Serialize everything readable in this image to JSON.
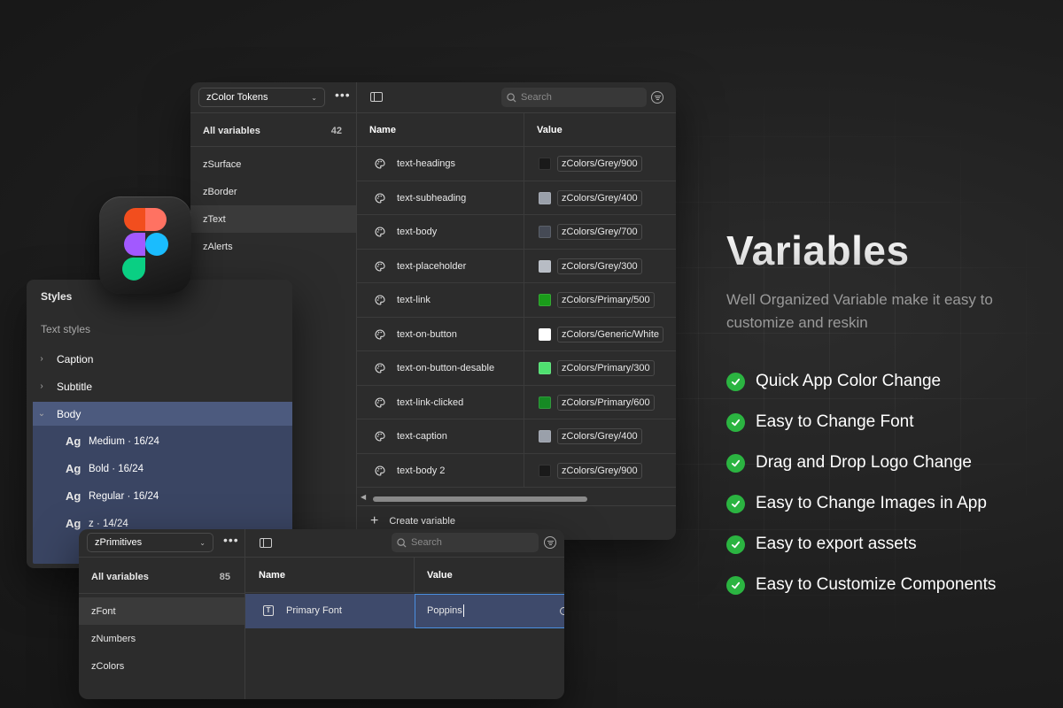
{
  "color_panel": {
    "collection": "zColor Tokens",
    "search_placeholder": "Search",
    "all_variables_label": "All variables",
    "all_variables_count": "42",
    "groups": [
      "zSurface",
      "zBorder",
      "zText",
      "zAlerts"
    ],
    "active_group": "zText",
    "col_name": "Name",
    "col_value": "Value",
    "rows": [
      {
        "name": "text-headings",
        "value": "zColors/Grey/900",
        "color": "#1a1a1a"
      },
      {
        "name": "text-subheading",
        "value": "zColors/Grey/400",
        "color": "#9aa0aa"
      },
      {
        "name": "text-body",
        "value": "zColors/Grey/700",
        "color": "#454a55"
      },
      {
        "name": "text-placeholder",
        "value": "zColors/Grey/300",
        "color": "#b7bcc4"
      },
      {
        "name": "text-link",
        "value": "zColors/Primary/500",
        "color": "#1a9c1a"
      },
      {
        "name": "text-on-button",
        "value": "zColors/Generic/White",
        "color": "#ffffff"
      },
      {
        "name": "text-on-button-desable",
        "value": "zColors/Primary/300",
        "color": "#4fe070"
      },
      {
        "name": "text-link-clicked",
        "value": "zColors/Primary/600",
        "color": "#168a24"
      },
      {
        "name": "text-caption",
        "value": "zColors/Grey/400",
        "color": "#9aa0aa"
      },
      {
        "name": "text-body 2",
        "value": "zColors/Grey/900",
        "color": "#1a1a1a"
      }
    ],
    "create_label": "Create variable"
  },
  "styles_panel": {
    "title": "Styles",
    "section": "Text styles",
    "items": [
      "Caption",
      "Subtitle",
      "Body"
    ],
    "body_styles": [
      {
        "ag": "Ag",
        "label": "Medium · 16/24"
      },
      {
        "ag": "Ag",
        "label": "Bold · 16/24"
      },
      {
        "ag": "Ag",
        "label": "Regular · 16/24"
      },
      {
        "ag": "Ag",
        "label": "z · 14/24"
      }
    ]
  },
  "primitives_panel": {
    "collection": "zPrimitives",
    "search_placeholder": "Search",
    "all_variables_label": "All variables",
    "all_variables_count": "85",
    "groups": [
      "zFont",
      "zNumbers",
      "zColors"
    ],
    "active_group": "zFont",
    "col_name": "Name",
    "col_value": "Value",
    "row_name": "Primary Font",
    "row_value": "Poppins"
  },
  "hero": {
    "title": "Variables",
    "subtitle": "Well Organized Variable make it easy to customize and reskin",
    "features": [
      "Quick App Color Change",
      "Easy to Change Font",
      "Drag and Drop Logo Change",
      "Easy to Change Images in App",
      "Easy to export assets",
      "Easy to Customize Components"
    ]
  },
  "colors": {
    "accent_green": "#2bb441",
    "selection_blue": "#3e4a6b",
    "figma_red": "#f24e1e",
    "figma_orange": "#ff7262",
    "figma_purple": "#a259ff",
    "figma_blue": "#1abcfe",
    "figma_green": "#0acf83"
  }
}
